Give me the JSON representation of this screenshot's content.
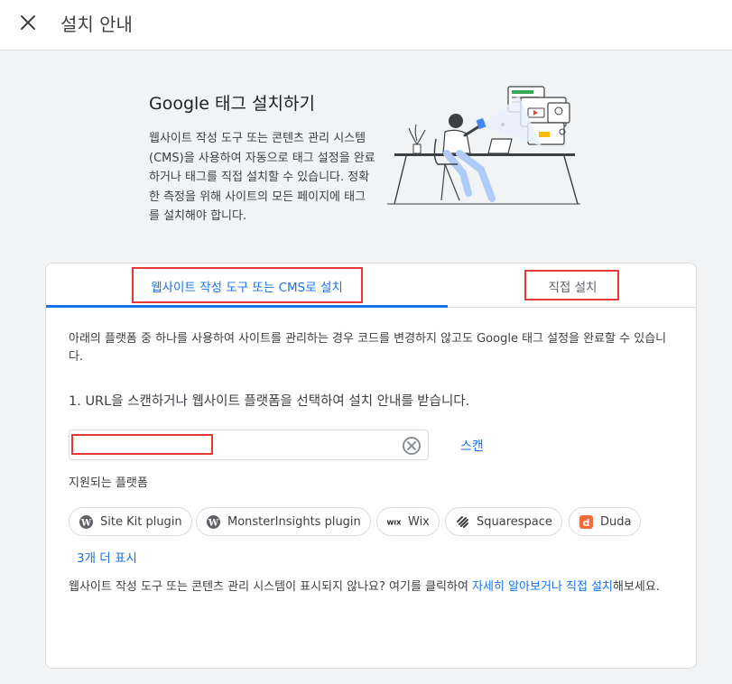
{
  "header": {
    "title": "설치 안내",
    "close_icon": "close-icon"
  },
  "hero": {
    "title": "Google 태그 설치하기",
    "description": "웹사이트 작성 도구 또는 콘텐츠 관리 시스템(CMS)을 사용하여 자동으로 태그 설정을 완료하거나 태그를 직접 설치할 수 있습니다. 정확한 측정을 위해 사이트의 모든 페이지에 태그를 설치해야 합니다."
  },
  "tabs": [
    {
      "label": "웹사이트 작성 도구 또는 CMS로 설치",
      "active": true
    },
    {
      "label": "직접 설치",
      "active": false
    }
  ],
  "main": {
    "description": "아래의 플랫폼 중 하나를 사용하여 사이트를 관리하는 경우 코드를 변경하지 않고도 Google 태그 설정을 완료할 수 있습니다.",
    "step1": "1. URL을 스캔하거나 웹사이트 플랫폼을 선택하여 설치 안내를 받습니다.",
    "url_input": {
      "value": "",
      "placeholder": ""
    },
    "scan_label": "스캔",
    "supported_label": "지원되는 플랫폼",
    "platforms": [
      {
        "label": "Site Kit plugin",
        "icon": "wordpress-icon"
      },
      {
        "label": "MonsterInsights plugin",
        "icon": "wordpress-icon"
      },
      {
        "label": "Wix",
        "icon": "wix-icon"
      },
      {
        "label": "Squarespace",
        "icon": "squarespace-icon"
      },
      {
        "label": "Duda",
        "icon": "duda-icon"
      }
    ],
    "show_more": "3개 더 표시",
    "footnote_text": "웹사이트 작성 도구 또는 콘텐츠 관리 시스템이 표시되지 않나요? 여기를 클릭하여 ",
    "footnote_link": "자세히 알아보거나 직접 설치",
    "footnote_suffix": "해보세요."
  },
  "colors": {
    "accent": "#1a73e8",
    "highlight": "#e53935",
    "background": "#f1f3f4"
  }
}
